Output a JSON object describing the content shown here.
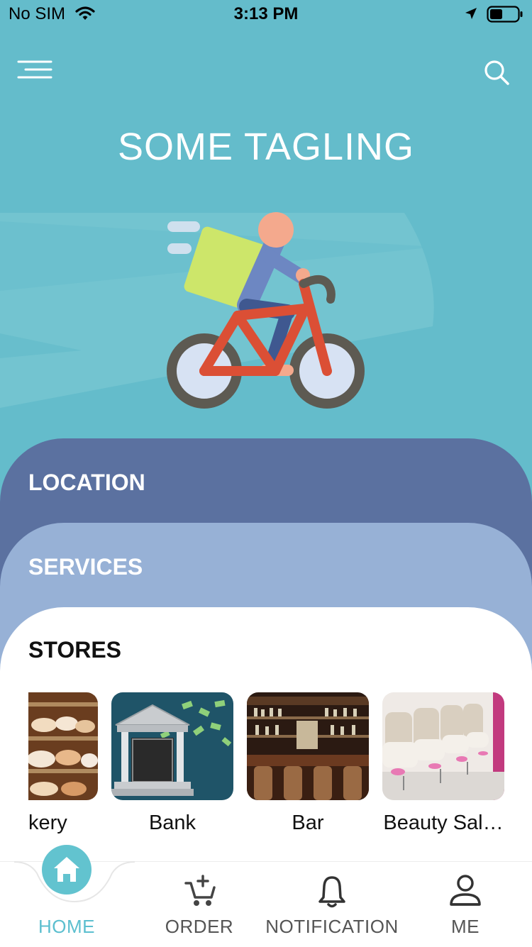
{
  "status_bar": {
    "carrier": "No SIM",
    "time": "3:13 PM"
  },
  "header": {
    "menu_icon": "hamburger-menu-icon",
    "search_icon": "search-icon",
    "tagline": "SOME TAGLING"
  },
  "hero": {
    "illustration": "delivery-cyclist-illustration"
  },
  "sections": {
    "location": "LOCATION",
    "services": "SERVICES",
    "stores": "STORES"
  },
  "stores": [
    {
      "label": "kery",
      "image": "bakery-photo"
    },
    {
      "label": "Bank",
      "image": "bank-illustration"
    },
    {
      "label": "Bar",
      "image": "bar-photo"
    },
    {
      "label": "Beauty Sal…",
      "image": "beauty-salon-photo"
    }
  ],
  "tabbar": {
    "home": "HOME",
    "order": "ORDER",
    "notification": "NOTIFICATION",
    "me": "ME",
    "active": "home"
  },
  "colors": {
    "background": "#64bccb",
    "location_card": "#5b71a0",
    "services_card": "#97b1d6",
    "accent": "#5cbfcf"
  }
}
